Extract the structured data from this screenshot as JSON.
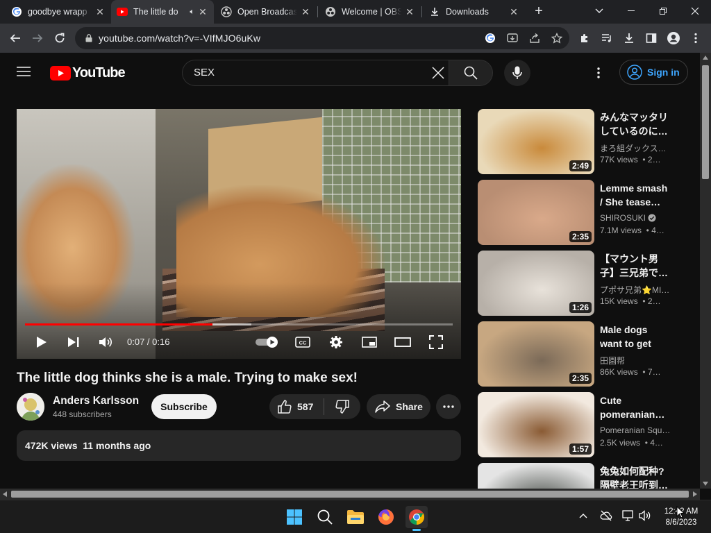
{
  "browser": {
    "tabs": [
      {
        "title": "goodbye wrapp",
        "icon": "google-g-icon"
      },
      {
        "title": "The little do",
        "icon": "youtube-icon",
        "audio": true
      },
      {
        "title": "Open Broadcast",
        "icon": "obs-icon"
      },
      {
        "title": "Welcome | OBS",
        "icon": "obs-icon"
      },
      {
        "title": "Downloads",
        "icon": "download-icon"
      }
    ],
    "url": "youtube.com/watch?v=-VIfMJO6uKw"
  },
  "youtube": {
    "logo_text": "YouTube",
    "search_query": "SEX",
    "sign_in": "Sign in"
  },
  "video": {
    "current_time": "0:07",
    "separator": " / ",
    "duration": "0:16",
    "progress_fraction": 0.4375,
    "buffered_fraction": 0.53,
    "title": "The little dog thinks she is a male. Trying to make sex!",
    "channel": "Anders Karlsson",
    "subscribers": "448 subscribers",
    "subscribe_label": "Subscribe",
    "likes": "587",
    "share_label": "Share",
    "views": "472K views",
    "age": "11 months ago"
  },
  "recommendations": [
    {
      "title": "みんなマッタリしているのに…",
      "channel": "まろ組ダックス…",
      "meta": "77K views  • 2…",
      "duration": "2:49",
      "colors": [
        "#c98a3b",
        "#e9d9b8"
      ]
    },
    {
      "title": "Lemme smash / She tease…",
      "channel": "SHIROSUKI",
      "verified": true,
      "meta": "7.1M views  • 4…",
      "duration": "2:35",
      "colors": [
        "#d9a98a",
        "#b98e73"
      ]
    },
    {
      "title": "【マウント男子】三兄弟で…",
      "channel": "プポサ兄弟⭐MI…",
      "meta": "15K views  • 2…",
      "duration": "1:26",
      "colors": [
        "#e8e2da",
        "#b7b0a8"
      ]
    },
    {
      "title": "Male dogs want to get married…",
      "channel": "田園帮",
      "meta": "86K views  • 7…",
      "duration": "2:35",
      "colors": [
        "#7b6a58",
        "#c7a781"
      ]
    },
    {
      "title": "Cute pomeranian…",
      "channel": "Pomeranian Squ…",
      "meta": "2.5K views  • 4…",
      "duration": "1:57",
      "colors": [
        "#8a5b34",
        "#f2e9df"
      ]
    },
    {
      "title": "兔兔如何配种?隔壁老王听到…",
      "channel": "",
      "meta": "",
      "duration": "",
      "colors": [
        "#4a4f4a",
        "#e4e4e4"
      ]
    }
  ],
  "taskbar": {
    "time": "12:42 AM",
    "date": "8/6/2023"
  }
}
